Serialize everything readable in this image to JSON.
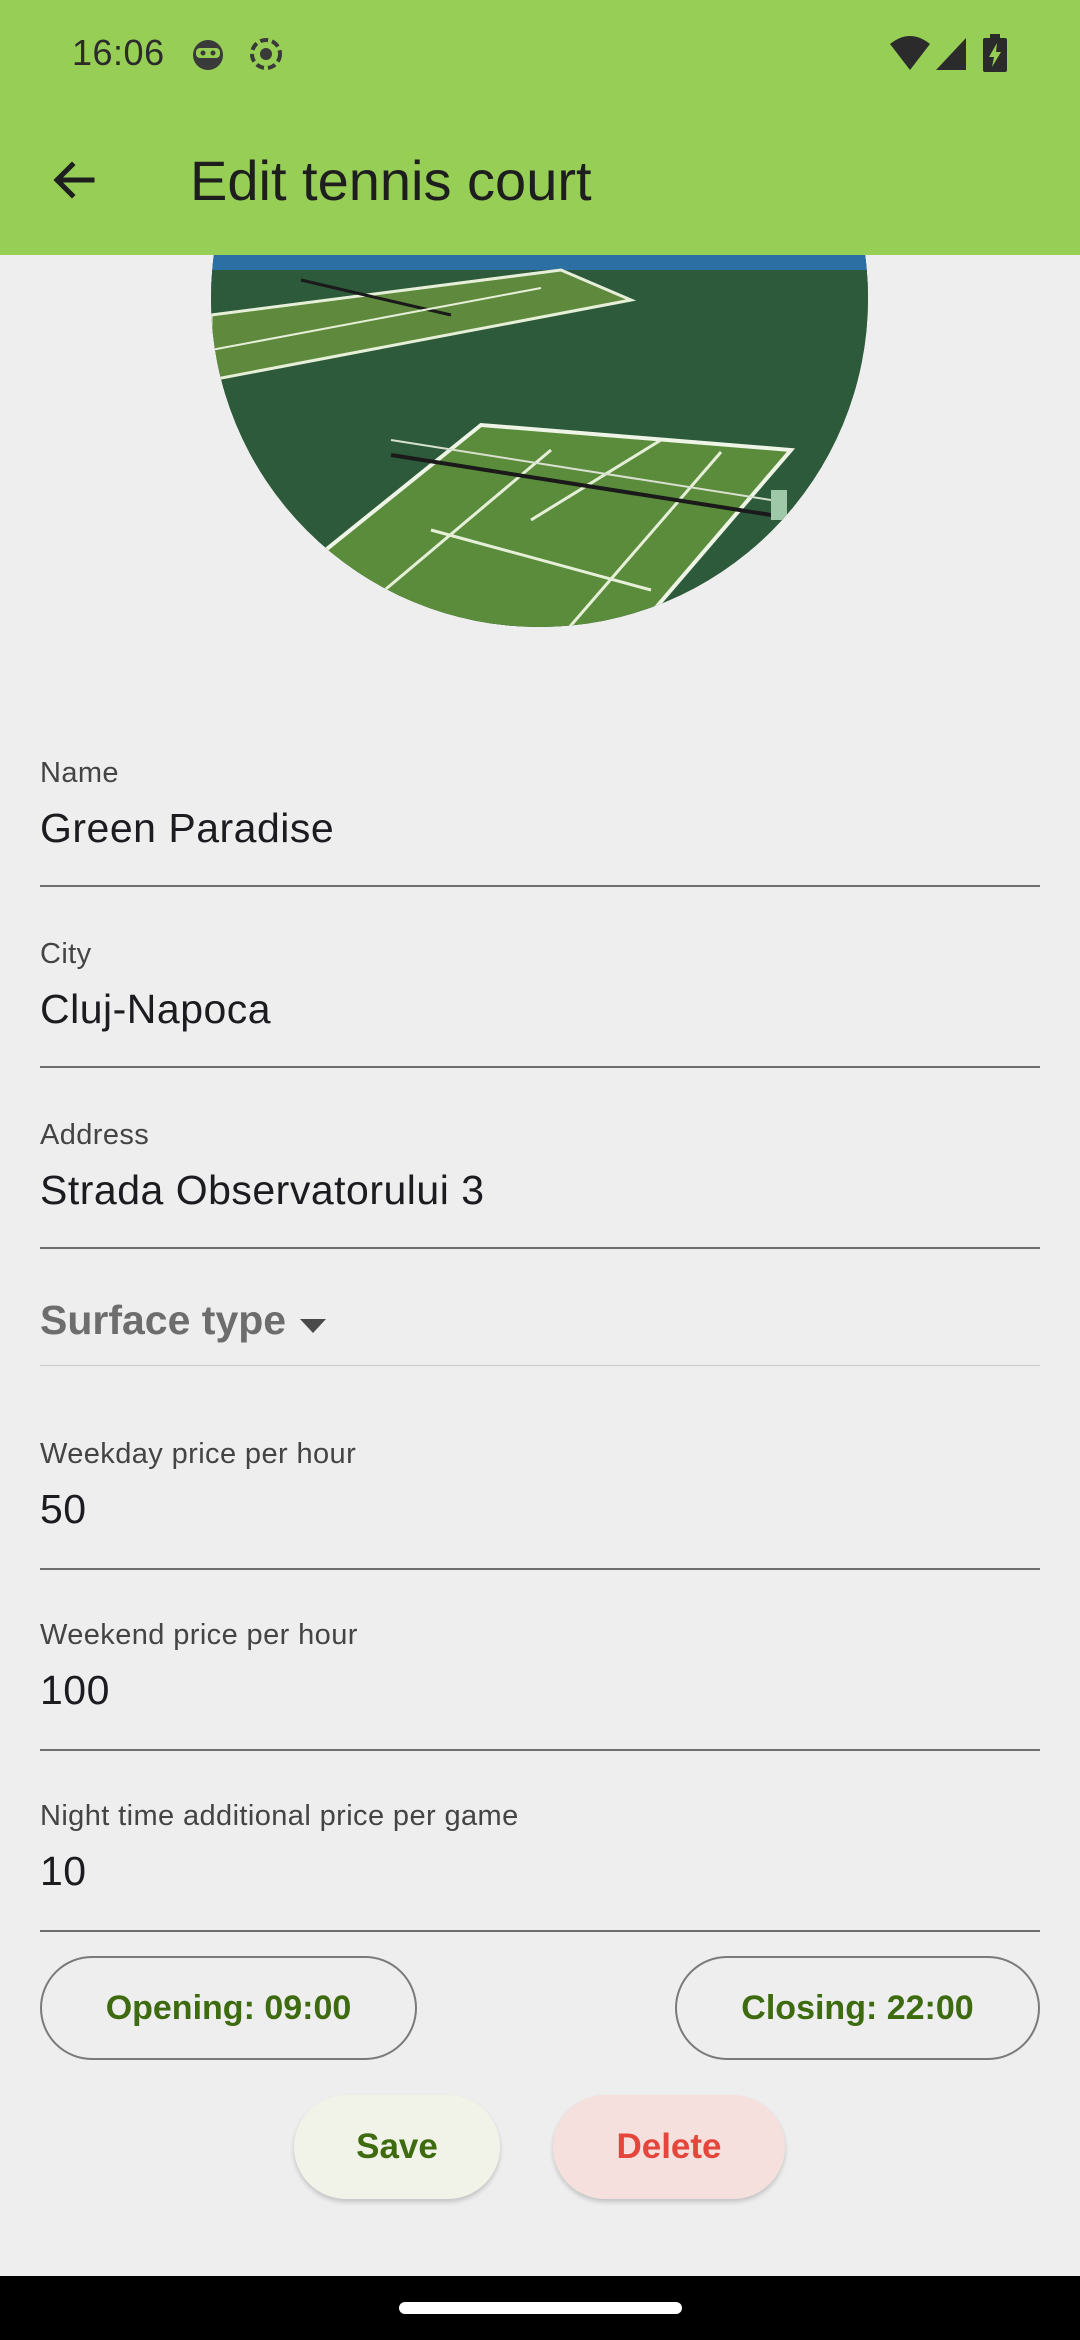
{
  "status_bar": {
    "time": "16:06",
    "icons": [
      "notification-face-icon",
      "screen-record-icon",
      "wifi-icon",
      "cell-signal-icon",
      "battery-charging-icon"
    ]
  },
  "app_bar": {
    "title": "Edit tennis court",
    "back_icon": "arrow-back-icon",
    "color": "#97ce55"
  },
  "court_image": {
    "alt": "tennis-court-photo"
  },
  "form": {
    "name": {
      "label": "Name",
      "value": "Green Paradise"
    },
    "city": {
      "label": "City",
      "value": "Cluj-Napoca"
    },
    "address": {
      "label": "Address",
      "value": "Strada Observatorului 3"
    },
    "surface_type": {
      "hint": "Surface type",
      "icon": "arrow-drop-down-icon"
    },
    "weekday_price": {
      "label": "Weekday price per hour",
      "value": "50"
    },
    "weekend_price": {
      "label": "Weekend price per hour",
      "value": "100"
    },
    "night_price": {
      "label": "Night time additional price per game",
      "value": "10"
    }
  },
  "hours": {
    "opening_label": "Opening: 09:00",
    "closing_label": "Closing: 22:00"
  },
  "actions": {
    "save_label": "Save",
    "delete_label": "Delete"
  },
  "colors": {
    "accent_text": "#3e6b10",
    "danger_text": "#e4463b",
    "background": "#eeeeee"
  }
}
